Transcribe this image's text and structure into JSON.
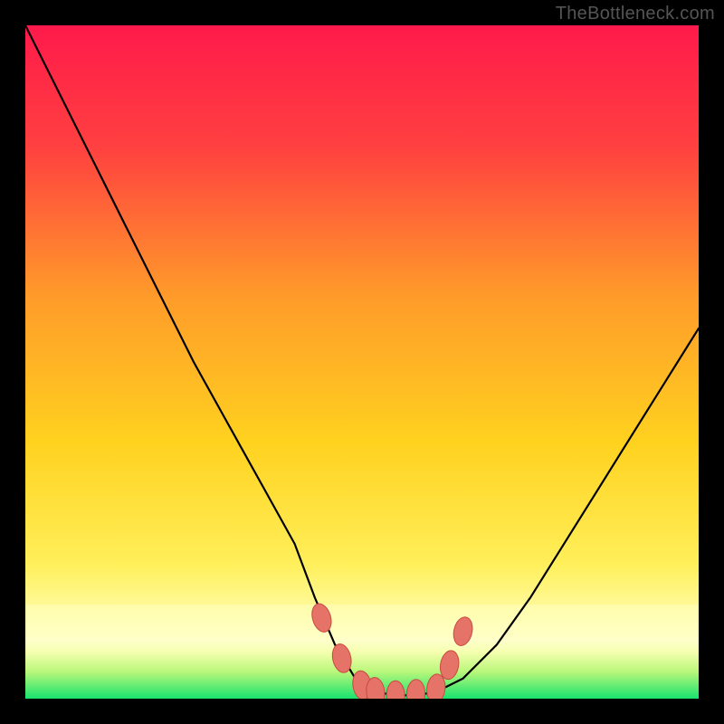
{
  "watermark": "TheBottleneck.com",
  "colors": {
    "frame": "#000000",
    "gradient_top": "#ff1a4b",
    "gradient_mid1": "#ff7a2a",
    "gradient_mid2": "#ffd21f",
    "gradient_low": "#fff98f",
    "gradient_band": "#ffffa0",
    "gradient_bottom": "#17e36e",
    "curve": "#000000",
    "marker_fill": "#e57368",
    "marker_stroke": "#c94a42"
  },
  "chart_data": {
    "type": "line",
    "title": "",
    "xlabel": "",
    "ylabel": "",
    "xlim": [
      0,
      100
    ],
    "ylim": [
      0,
      100
    ],
    "series": [
      {
        "name": "bottleneck-curve",
        "x": [
          0,
          5,
          10,
          15,
          20,
          25,
          30,
          35,
          40,
          43,
          46,
          49,
          52,
          55,
          58,
          61,
          65,
          70,
          75,
          80,
          85,
          90,
          95,
          100
        ],
        "y": [
          100,
          90,
          80,
          70,
          60,
          50,
          41,
          32,
          23,
          15,
          8,
          3,
          1,
          0.5,
          0.5,
          1,
          3,
          8,
          15,
          23,
          31,
          39,
          47,
          55
        ]
      }
    ],
    "markers": {
      "name": "highlighted-points",
      "x": [
        44,
        47,
        50,
        52,
        55,
        58,
        61,
        63,
        65
      ],
      "y": [
        12,
        6,
        2,
        1,
        0.5,
        0.7,
        1.5,
        5,
        10
      ]
    },
    "notes": "Axes have no visible tick labels or numbers; background is a vertical red→orange→yellow→green gradient; curve is a V-shaped bottleneck profile with pink oval markers near the trough."
  }
}
